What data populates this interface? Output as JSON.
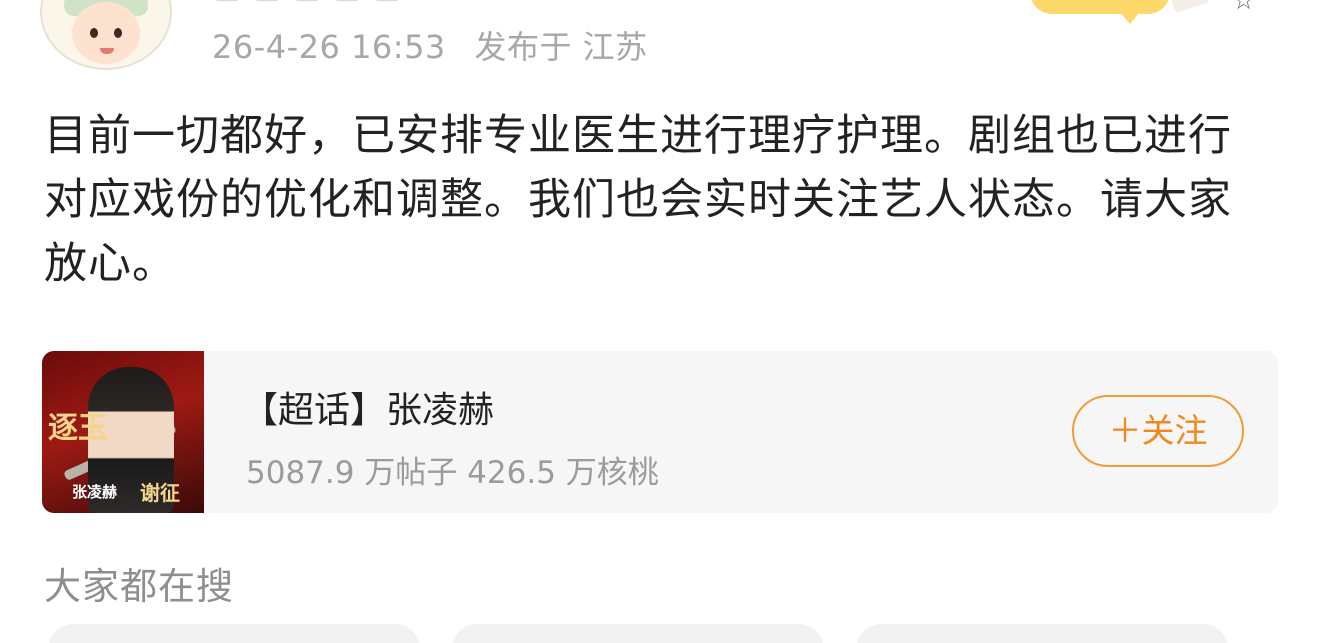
{
  "header": {
    "timestamp": "26-4-26 16:53",
    "location": "发布于 江苏",
    "avatar_icon": "cartoon-avatar-icon",
    "star_icon": "star-outline-icon"
  },
  "post": {
    "text": "目前一切都好，已安排专业医生进行理疗护理。剧组也已进行对应戏份的优化和调整。我们也会实时关注艺人状态。请大家放心。"
  },
  "super_topic": {
    "title": "【超话】张凌赫",
    "stats": "5087.9 万帖子 426.5 万核桃",
    "follow_label": "＋关注",
    "thumbnail": {
      "calligraphy": "逐玉",
      "caption_left": "张凌赫",
      "caption_right": "谢征"
    },
    "accent_color": "#f0891c"
  },
  "search_section": {
    "title": "大家都在搜"
  }
}
